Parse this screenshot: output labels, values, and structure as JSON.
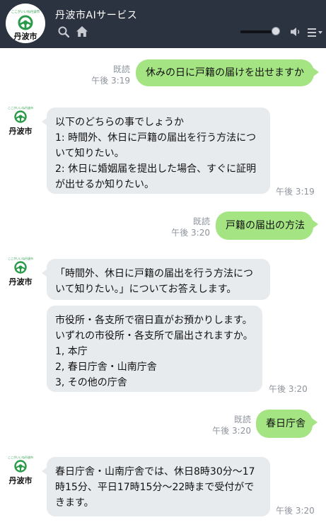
{
  "header": {
    "title": "丹波市AIサービス",
    "logo_text": "丹波市",
    "logo_tag": "ここがいいね丹波市",
    "volume_level": 0.9,
    "icons": {
      "search": "search-icon",
      "home": "home-icon",
      "volume": "volume-icon",
      "menu": "menu-icon"
    },
    "colors": {
      "header_bg": "#2c3340",
      "brand_green": "#2a9a4a"
    }
  },
  "bot_avatar": {
    "label": "丹波市",
    "tag": "ここがいいね丹波市"
  },
  "messages": [
    {
      "type": "user",
      "read": "既読",
      "time": "午後 3:19",
      "text": "休みの日に戸籍の届けを出せますか"
    },
    {
      "type": "bot",
      "time": "午後 3:19",
      "lines": [
        "以下のどちらの事でしょうか",
        "1: 時間外、休日に戸籍の届出を行う方法につ",
        "いて知りたい。",
        "2: 休日に婚姻届を提出した場合、すぐに証明",
        "が出せるか知りたい。"
      ]
    },
    {
      "type": "user",
      "read": "既読",
      "time": "午後 3:20",
      "text": "戸籍の届出の方法"
    },
    {
      "type": "bot",
      "lines": [
        "「時間外、休日に戸籍の届出を行う方法につ",
        "いて知りたい。」についてお答えします。"
      ]
    },
    {
      "type": "bot",
      "time": "午後 3:20",
      "lines": [
        "市役所・各支所で宿日直がお預かりします。",
        "いずれの市役所・各支所で届出されますか。",
        "1, 本庁",
        "2, 春日庁舎・山南庁舎",
        "3, その他の庁舎"
      ]
    },
    {
      "type": "user",
      "read": "既読",
      "time": "午後 3:20",
      "text": "春日庁舎"
    },
    {
      "type": "bot",
      "time": "午後 3:20",
      "lines": [
        "春日庁舎・山南庁舎では、休日8時30分〜17",
        "時15分、平日17時15分〜22時まで受付がで",
        "きます。"
      ]
    }
  ]
}
